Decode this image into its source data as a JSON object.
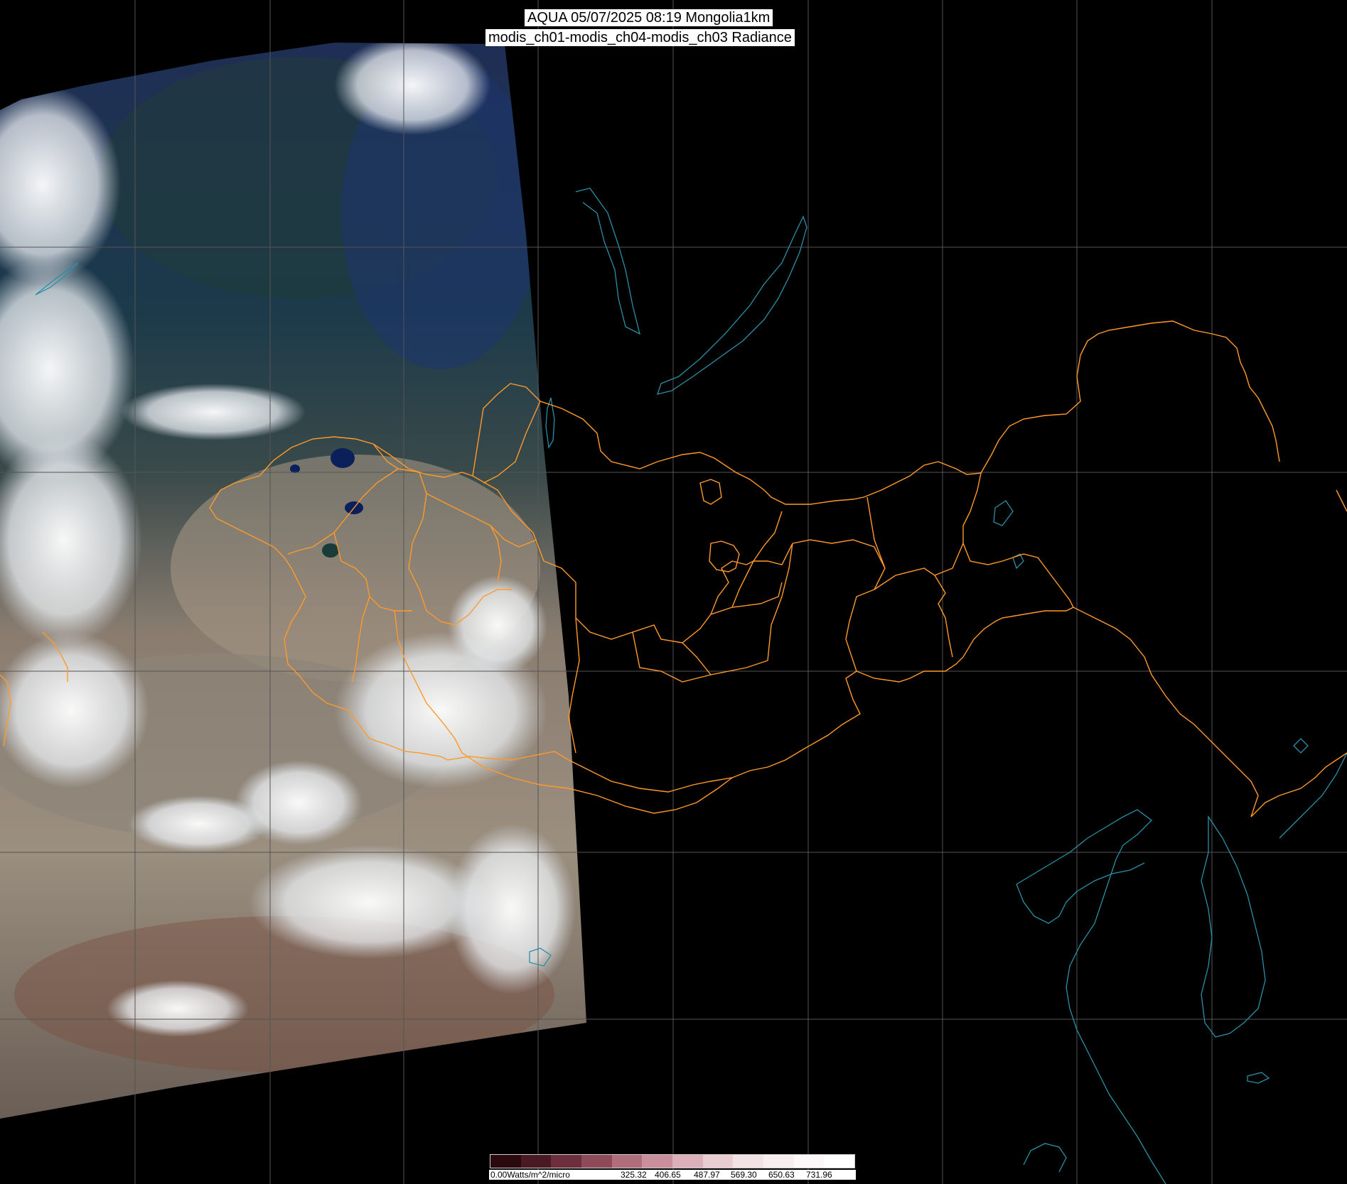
{
  "header": {
    "title_line1": "AQUA 05/07/2025 08:19 Mongolia1km",
    "title_line2": "modis_ch01-modis_ch04-modis_ch03 Radiance"
  },
  "legend": {
    "unit_label": "0.00Watts/m^2/micro",
    "ticks": [
      "325.32",
      "406.65",
      "487.97",
      "569.30",
      "650.63",
      "731.96"
    ],
    "colors": [
      "#2a0a0e",
      "#4a1a24",
      "#6d2e3d",
      "#8f4a5a",
      "#b06d7c",
      "#c98f9c",
      "#dbb0ba",
      "#e8cdd3",
      "#f2e1e5",
      "#f8eef0",
      "#fcf7f8",
      "#ffffff"
    ]
  },
  "colors": {
    "grid": "#555555",
    "border_orange": "#ff9a2a",
    "coast_cyan": "#2b8fa6",
    "background": "#000000"
  }
}
